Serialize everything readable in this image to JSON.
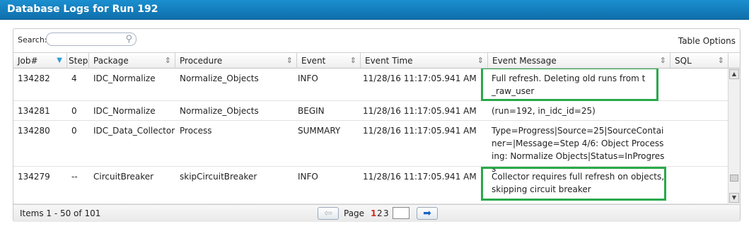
{
  "window": {
    "title": "Database Logs for Run 192"
  },
  "toolbar": {
    "search_label": "Search:",
    "search_value": "",
    "table_options": "Table Options"
  },
  "columns": [
    {
      "label": "Job#",
      "indicator": "▼"
    },
    {
      "label": "Step"
    },
    {
      "label": "Package",
      "indicator": "⇕"
    },
    {
      "label": "Procedure",
      "indicator": "⇕"
    },
    {
      "label": "Event",
      "indicator": "⇕"
    },
    {
      "label": "Event Time",
      "indicator": "⇕"
    },
    {
      "label": "Event Message",
      "indicator": "⇕"
    },
    {
      "label": "SQL",
      "indicator": "⇕"
    }
  ],
  "rows": [
    {
      "job": "134282",
      "step": "4",
      "package": "IDC_Normalize",
      "procedure": "Normalize_Objects",
      "event": "INFO",
      "time": "11/28/16 11:17:05.941 AM",
      "message": "Full refresh. Deleting old runs from t_raw_user",
      "sql": ""
    },
    {
      "job": "134281",
      "step": "0",
      "package": "IDC_Normalize",
      "procedure": "Normalize_Objects",
      "event": "BEGIN",
      "time": "11/28/16 11:17:05.941 AM",
      "message": "(run=192, in_idc_id=25)",
      "sql": ""
    },
    {
      "job": "134280",
      "step": "0",
      "package": "IDC_Data_Collector",
      "procedure": "Process",
      "event": "SUMMARY",
      "time": "11/28/16 11:17:05.941 AM",
      "message": "Type=Progress|Source=25|SourceContainer=|Message=Step 4/6: Object Processing: Normalize Objects|Status=InProgress",
      "sql": ""
    },
    {
      "job": "134279",
      "step": "--",
      "package": "CircuitBreaker",
      "procedure": "skipCircuitBreaker",
      "event": "INFO",
      "time": "11/28/16 11:17:05.941 AM",
      "message": "Collector requires full refresh on objects, skipping circuit breaker",
      "sql": ""
    }
  ],
  "footer": {
    "items_text": "Items 1 - 50 of 101",
    "page_label": "Page",
    "pages": [
      "1",
      "2",
      "3"
    ],
    "current_page": "1",
    "page_input_value": ""
  },
  "colors": {
    "title_bar": "#1580c2",
    "highlight": "#2aa84a",
    "current_page": "#d42a1e"
  }
}
